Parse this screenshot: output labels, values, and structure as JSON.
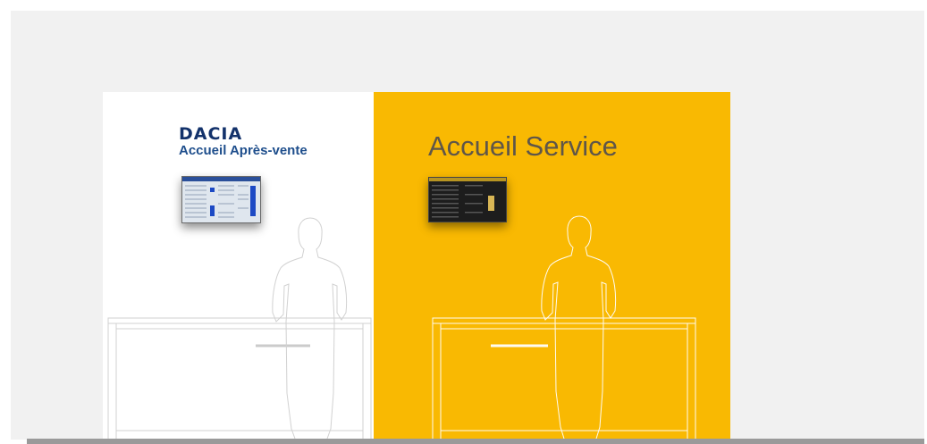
{
  "left_desk": {
    "brand": "DACIA",
    "title": "Accueil Après-vente"
  },
  "right_desk": {
    "title": "Accueil Service"
  },
  "colors": {
    "wall": "#f1f1f1",
    "yellow_panel": "#f9b902",
    "brand_blue": "#13326b",
    "outline": "#ffffff"
  },
  "icons": [
    "person-silhouette-icon",
    "counter-desk-icon",
    "display-screen-icon"
  ]
}
